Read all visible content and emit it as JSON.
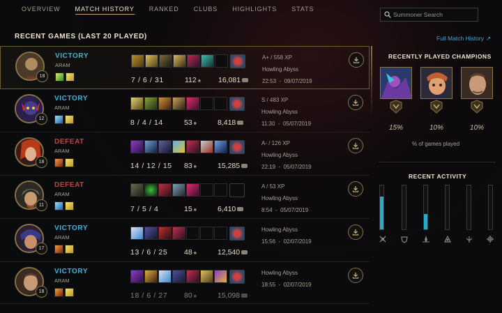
{
  "nav": {
    "tabs": [
      {
        "label": "OVERVIEW",
        "active": false
      },
      {
        "label": "MATCH HISTORY",
        "active": true
      },
      {
        "label": "RANKED",
        "active": false
      },
      {
        "label": "CLUBS",
        "active": false
      },
      {
        "label": "HIGHLIGHTS",
        "active": false
      },
      {
        "label": "STATS",
        "active": false
      }
    ],
    "search_placeholder": "Summoner Search"
  },
  "section_title": "RECENT GAMES (LAST 20 PLAYED)",
  "full_history_link": "Full Match History",
  "full_history_arrow": "↗",
  "games": [
    {
      "result": "VICTORY",
      "mode": "ARAM",
      "level": "18",
      "kda": "7 / 6 / 31",
      "cs": "112",
      "gold": "16,081",
      "grade": "A+ / 558 XP",
      "map": "Howling Abyss",
      "datetime": "22:53  -  09/07/2019"
    },
    {
      "result": "VICTORY",
      "mode": "ARAM",
      "level": "12",
      "kda": "8 / 4 / 14",
      "cs": "53",
      "gold": "8,418",
      "grade": "S / 483 XP",
      "map": "Howling Abyss",
      "datetime": "11:30  -  05/07/2019"
    },
    {
      "result": "DEFEAT",
      "mode": "ARAM",
      "level": "18",
      "kda": "14 / 12 / 15",
      "cs": "83",
      "gold": "15,285",
      "grade": "A- / 126 XP",
      "map": "Howling Abyss",
      "datetime": "22:19  -  05/07/2019"
    },
    {
      "result": "DEFEAT",
      "mode": "ARAM",
      "level": "11",
      "kda": "7 / 5 / 4",
      "cs": "15",
      "gold": "6,410",
      "grade": "A / 53 XP",
      "map": "Howling Abyss",
      "datetime": "8:54  -  05/07/2019"
    },
    {
      "result": "VICTORY",
      "mode": "ARAM",
      "level": "17",
      "kda": "13 / 6 / 25",
      "cs": "48",
      "gold": "12,540",
      "grade": "",
      "map": "Howling Abyss",
      "datetime": "15:56  -  02/07/2019"
    },
    {
      "result": "VICTORY",
      "mode": "ARAM",
      "level": "18",
      "kda": "18 / 6 / 27",
      "cs": "80",
      "gold": "15,098",
      "grade": "",
      "map": "Howling Abyss",
      "datetime": "18:55  -  02/07/2019"
    }
  ],
  "recent_champions": {
    "title": "RECENTLY PLAYED CHAMPIONS",
    "percentages": [
      "15%",
      "10%",
      "10%"
    ],
    "caption": "% of games played"
  },
  "recent_activity": {
    "title": "RECENT ACTIVITY",
    "fill_fractions": [
      0.75,
      0,
      0.35,
      0,
      0,
      0,
      0
    ]
  },
  "colors": {
    "victory": "#3fb4d8",
    "defeat": "#d43c3c",
    "gold_accent": "#c8aa6e",
    "link": "#3fa8d4"
  }
}
